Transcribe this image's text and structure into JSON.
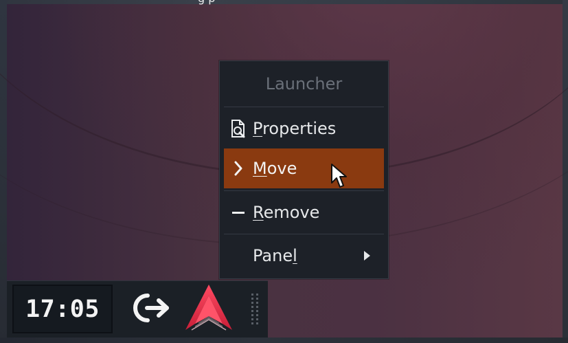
{
  "top_hint": {
    "text": "g                                p"
  },
  "context_menu": {
    "title": "Launcher",
    "items": [
      {
        "label_prefix": "",
        "mnemonic": "P",
        "label_suffix": "roperties",
        "icon": "document-properties-icon",
        "active": false,
        "has_submenu": false
      },
      {
        "label_prefix": "",
        "mnemonic": "M",
        "label_suffix": "ove",
        "icon": "chevron-right-icon",
        "active": true,
        "has_submenu": false
      },
      {
        "label_prefix": "",
        "mnemonic": "R",
        "label_suffix": "emove",
        "icon": "minus-icon",
        "active": false,
        "has_submenu": false
      },
      {
        "label_prefix": "Pane",
        "mnemonic": "l",
        "label_suffix": "",
        "icon": "",
        "active": false,
        "has_submenu": true
      }
    ]
  },
  "panel": {
    "clock": "17:05",
    "logout_icon": "logout-icon",
    "launcher_icon": "launcher-app-icon"
  },
  "colors": {
    "active_item": "#8a3a10",
    "menu_background": "#1d2128",
    "panel_background": "#1b2026",
    "launcher_red": "#e5344c"
  }
}
